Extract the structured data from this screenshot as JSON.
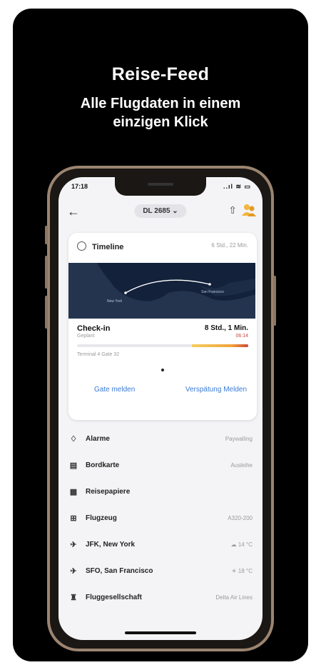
{
  "promo": {
    "title": "Reise-Feed",
    "subtitle_line1": "Alle Flugdaten in einem",
    "subtitle_line2": "einzigen Klick"
  },
  "status_bar": {
    "time": "17:18",
    "icons": "..ıl ≋ ▭"
  },
  "nav": {
    "back": "←",
    "flight": "DL 2685 ⌄",
    "share": "⇧"
  },
  "timeline": {
    "label": "Timeline",
    "duration": "6 Std., 22 Min.",
    "map_labels": {
      "start": "New York",
      "end": "San Francisco"
    },
    "checkin_label": "Check-in",
    "checkin_sub": "Geplant",
    "checkin_time": "8 Std., 1 Min.",
    "checkin_time_sub": "06:14",
    "progress_fraction": 0.33,
    "terminal": "Terminal 4 Gate 32",
    "actions": [
      "Gate melden",
      "Verspätung Melden"
    ]
  },
  "list": [
    {
      "icon": "bell-icon",
      "glyph": "♢",
      "label": "Alarme",
      "value": "Paywalling"
    },
    {
      "icon": "boarding-pass-icon",
      "glyph": "▤",
      "label": "Bordkarte",
      "value": "Ausleihe"
    },
    {
      "icon": "document-icon",
      "glyph": "▦",
      "label": "Reisepapiere",
      "value": ""
    },
    {
      "icon": "plane-grid-icon",
      "glyph": "⊞",
      "label": "Flugzeug",
      "value": "A320-200"
    },
    {
      "icon": "departure-icon",
      "glyph": "✈",
      "label": "JFK, New York",
      "value": "☁ 14 °C"
    },
    {
      "icon": "arrival-icon",
      "glyph": "✈",
      "label": "SFO, San Francisco",
      "value": "☀ 18 °C"
    },
    {
      "icon": "airline-icon",
      "glyph": "♜",
      "label": "Fluggesellschaft",
      "value": "Delta Air Lines"
    }
  ],
  "colors": {
    "accent": "#3a7bd5",
    "alert": "#d2453a",
    "warning": "#f0a43a",
    "map_bg": "#24344f"
  }
}
